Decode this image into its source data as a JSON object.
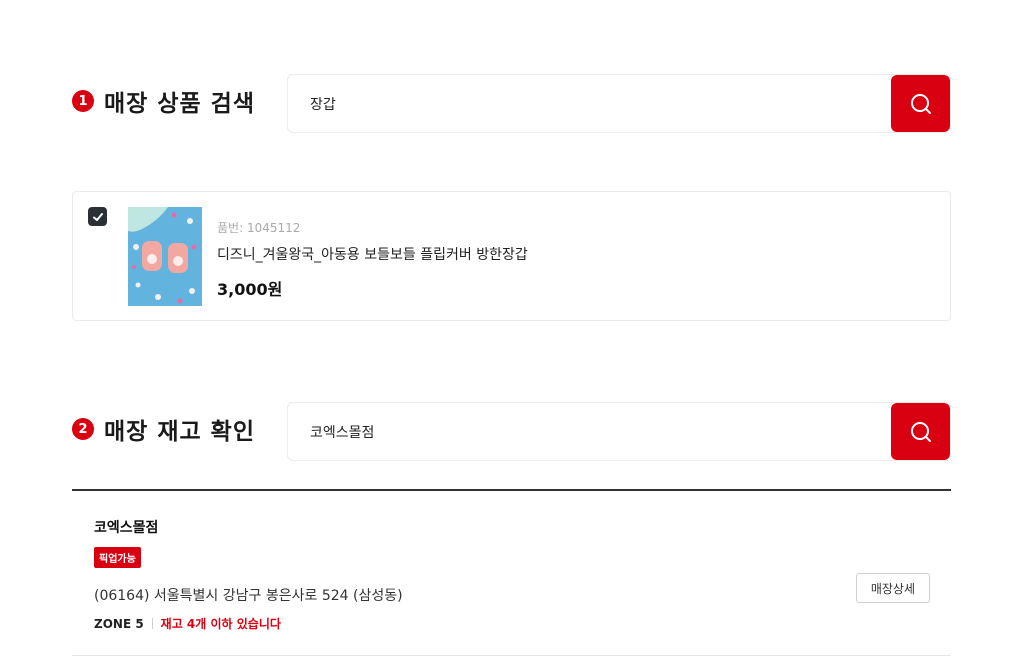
{
  "product_search": {
    "step": "1",
    "title": "매장 상품 검색",
    "query": "장갑"
  },
  "product": {
    "checked": true,
    "code": "품번: 1045112",
    "name": "디즈니_겨울왕국_아동용 보들보들 플립커버 방한장갑",
    "price": "3,000원"
  },
  "stock_check": {
    "step": "2",
    "title": "매장 재고 확인",
    "query": "코엑스몰점"
  },
  "stores": [
    {
      "name": "코엑스몰점",
      "badge": "픽업가능",
      "address": "(06164) 서울특별시 강남구 봉은사로 524 (삼성동)",
      "zone": "ZONE 5",
      "stock": "재고 4개 이하 있습니다",
      "detail_label": "매장상세"
    }
  ],
  "colors": {
    "accent": "#d90012",
    "checkbox": "#2b2f36"
  },
  "icons": {
    "search": "search-icon",
    "check": "check-icon"
  }
}
